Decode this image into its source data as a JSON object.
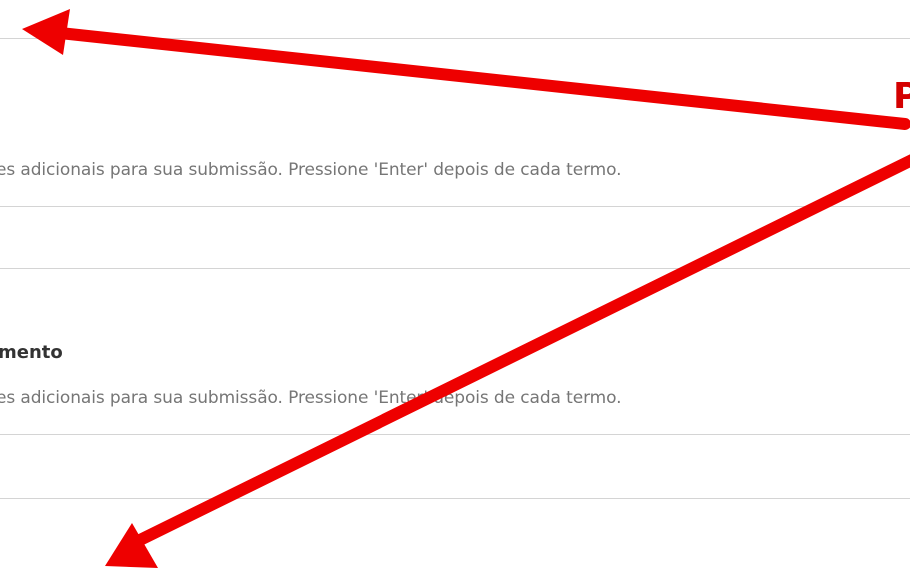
{
  "form": {
    "rule_1": "",
    "field_1": {
      "hint": "es adicionais para sua submissão. Pressione 'Enter' depois de cada termo."
    },
    "field_2": {
      "label": "mento",
      "hint": "es adicionais para sua submissão. Pressione 'Enter' depois de cada termo."
    }
  },
  "annotation": {
    "letter": "P",
    "arrow_color": "#ee0000",
    "letter_color": "#d40000"
  }
}
